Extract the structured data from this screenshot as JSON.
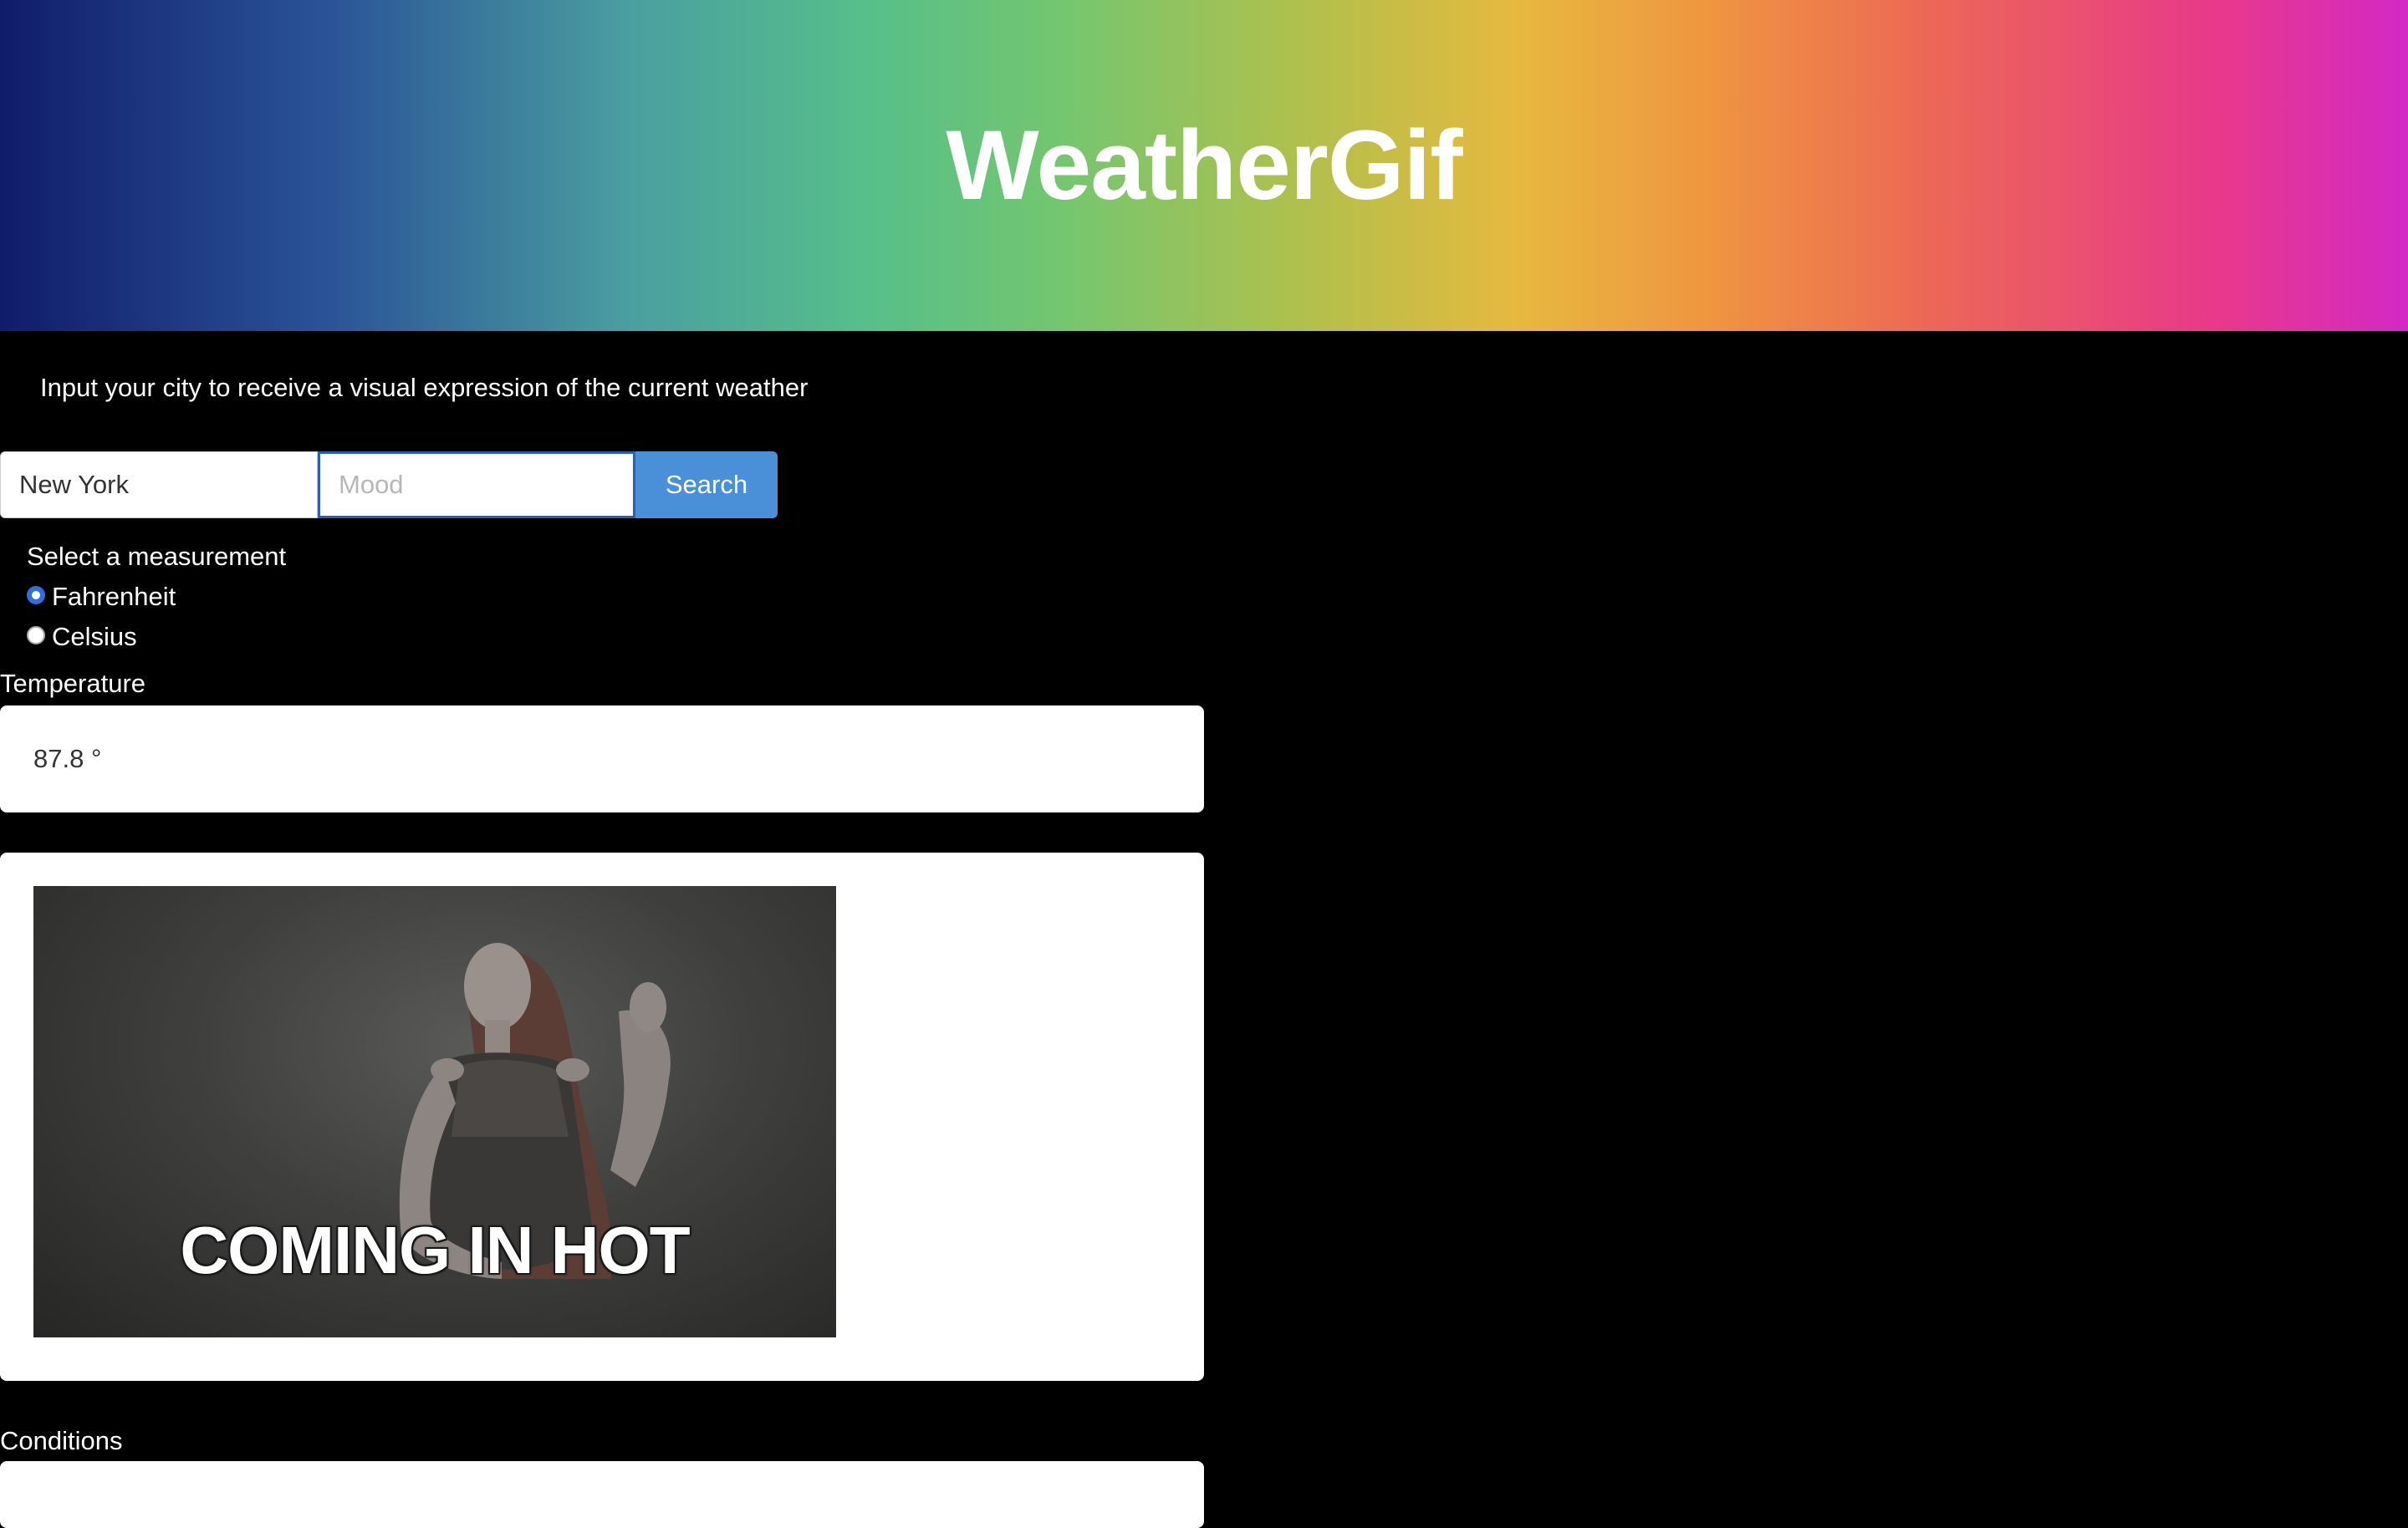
{
  "header": {
    "title": "WeatherGif"
  },
  "intro": {
    "text": "Input your city to receive a visual expression of the current weather"
  },
  "search": {
    "city_value": "New York",
    "mood_placeholder": "Mood",
    "button_label": "Search"
  },
  "measurement": {
    "label": "Select a measurement",
    "options": [
      {
        "label": "Fahrenheit",
        "selected": true
      },
      {
        "label": "Celsius",
        "selected": false
      }
    ]
  },
  "temperature": {
    "label": "Temperature",
    "value": "87.8 °"
  },
  "gif": {
    "caption": "COMING IN HOT"
  },
  "conditions": {
    "label": "Conditions"
  },
  "colors": {
    "accent": "#4a90d9",
    "background": "#000000"
  }
}
